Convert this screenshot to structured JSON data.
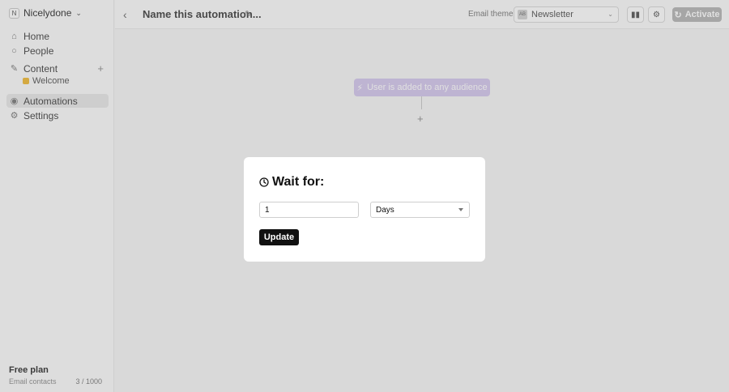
{
  "sidebar": {
    "workspace_badge": "N",
    "workspace_name": "Nicelydone",
    "items": [
      {
        "label": "Home",
        "icon": "home-icon"
      },
      {
        "label": "People",
        "icon": "person-icon"
      },
      {
        "label": "Content",
        "icon": "pen-icon"
      },
      {
        "label": "Automations",
        "icon": "automation-icon"
      },
      {
        "label": "Settings",
        "icon": "gear-icon"
      }
    ],
    "content_sub_item": "Welcome",
    "plan": "Free plan",
    "contacts_label": "Email contacts",
    "contacts_value": "3 / 1000"
  },
  "header": {
    "title": "Name this automation...",
    "email_theme_label": "Email theme:",
    "theme_badge": "AB",
    "theme_value": "Newsletter",
    "activate_label": "Activate"
  },
  "canvas": {
    "trigger_label": "User is added to any audience"
  },
  "modal": {
    "title": "Wait for:",
    "amount_value": "1",
    "unit_value": "Days",
    "update_label": "Update"
  }
}
